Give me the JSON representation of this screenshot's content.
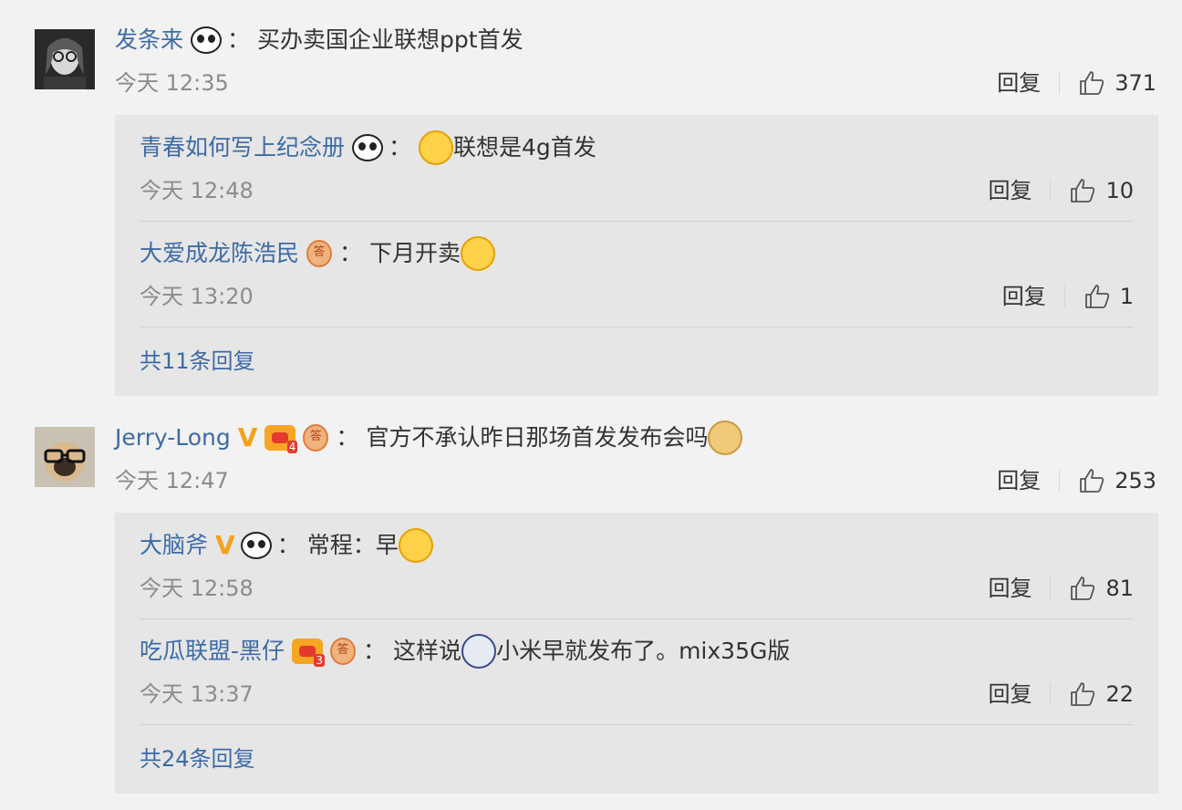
{
  "comments": [
    {
      "user": "发条来",
      "content": "买办卖国企业联想ppt首发",
      "time": "今天 12:35",
      "reply_label": "回复",
      "likes": "371",
      "replies": [
        {
          "user": "青春如何写上纪念册",
          "content": "联想是4g首发",
          "time": "今天 12:48",
          "reply_label": "回复",
          "likes": "10"
        },
        {
          "user": "大爱成龙陈浩民",
          "content": "下月开卖",
          "time": "今天 13:20",
          "reply_label": "回复",
          "likes": "1"
        }
      ],
      "more_replies": "共11条回复"
    },
    {
      "user": "Jerry-Long",
      "content": "官方不承认昨日那场首发发布会吗",
      "time": "今天 12:47",
      "reply_label": "回复",
      "likes": "253",
      "badges": {
        "vip_level": "4"
      },
      "replies": [
        {
          "user": "大脑斧",
          "content_prefix": "常程：早",
          "time": "今天 12:58",
          "reply_label": "回复",
          "likes": "81"
        },
        {
          "user": "吃瓜联盟-黑仔",
          "content_prefix": "这样说",
          "content_suffix": "小米早就发布了。mix35G版",
          "time": "今天 13:37",
          "reply_label": "回复",
          "likes": "22",
          "badges": {
            "vip_level": "3"
          }
        }
      ],
      "more_replies": "共24条回复"
    }
  ],
  "colon": "：",
  "colors": {
    "link": "#3d6ba6",
    "muted": "#8c8c8c",
    "bg": "#f2f2f2",
    "reply_bg": "#e6e6e6",
    "badge_v": "#f4a21c"
  }
}
